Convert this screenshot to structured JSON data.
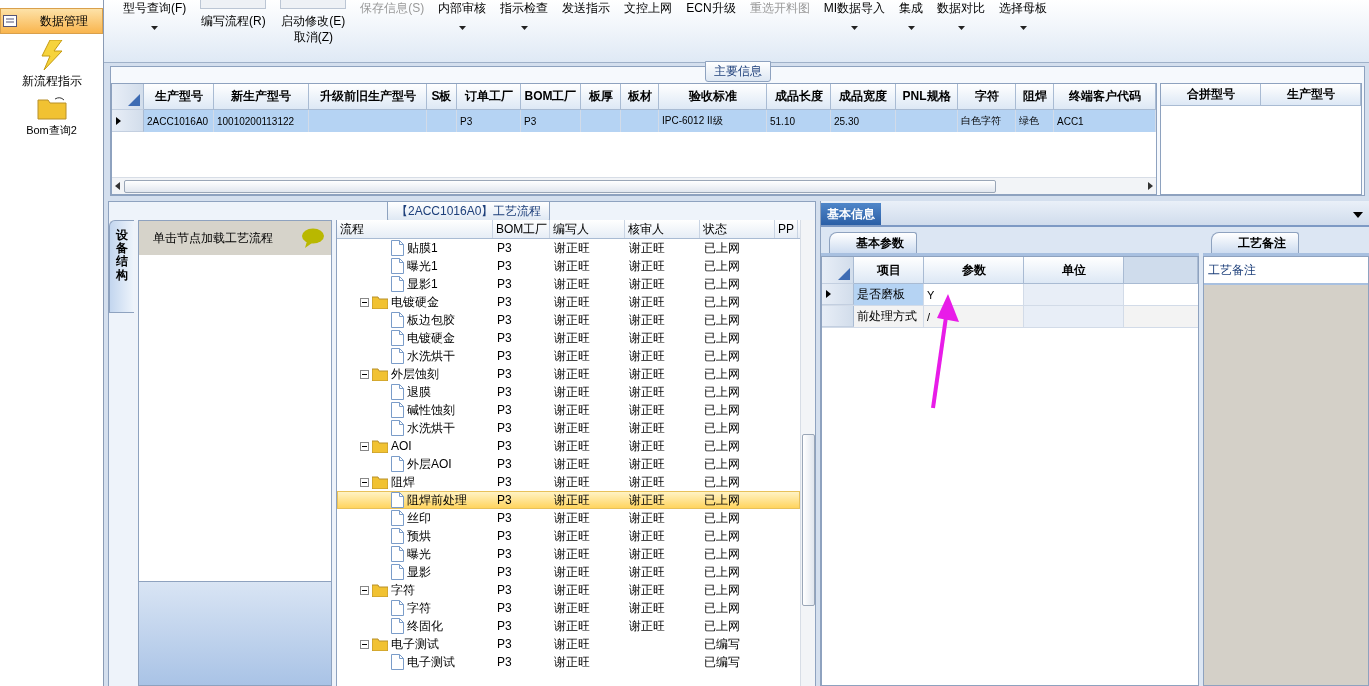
{
  "sidebar": {
    "items": [
      {
        "label": "数据管理",
        "kind": "nav",
        "selected": true
      },
      {
        "label": "新流程指示",
        "kind": "launcher",
        "selected": false
      },
      {
        "label": "Bom查询2",
        "kind": "launcher",
        "selected": false
      }
    ]
  },
  "toolbar": {
    "items": [
      {
        "label": "型号查询(F)",
        "kind": "text",
        "caret": true,
        "disabled": false
      },
      {
        "label": "编写流程(R)",
        "kind": "icon",
        "caret": false,
        "disabled": false
      },
      {
        "label": "启动修改(E)",
        "second_line": "取消(Z)",
        "kind": "icon",
        "caret": false,
        "disabled": false
      },
      {
        "label": "保存信息(S)",
        "kind": "text",
        "caret": false,
        "disabled": true
      },
      {
        "label": "内部审核",
        "kind": "text",
        "caret": true,
        "disabled": false
      },
      {
        "label": "指示检查",
        "kind": "text",
        "caret": true,
        "disabled": false
      },
      {
        "label": "发送指示",
        "kind": "text",
        "caret": false,
        "disabled": false
      },
      {
        "label": "文控上网",
        "kind": "text",
        "caret": false,
        "disabled": false
      },
      {
        "label": "ECN升级",
        "kind": "text",
        "caret": false,
        "disabled": false
      },
      {
        "label": "重选开料图",
        "kind": "text",
        "caret": false,
        "disabled": true
      },
      {
        "label": "MI数据导入",
        "kind": "text",
        "caret": true,
        "disabled": false
      },
      {
        "label": "集成",
        "kind": "text",
        "caret": true,
        "disabled": false
      },
      {
        "label": "数据对比",
        "kind": "text",
        "caret": true,
        "disabled": false
      },
      {
        "label": "选择母板",
        "kind": "text",
        "caret": true,
        "disabled": false
      }
    ]
  },
  "main_info": {
    "title": "主要信息",
    "table": {
      "columns": [
        "生产型号",
        "新生产型号",
        "升级前旧生产型号",
        "S板",
        "订单工厂",
        "BOM工厂",
        "板厚",
        "板材",
        "验收标准",
        "成品长度",
        "成品宽度",
        "PNL规格",
        "字符",
        "阻焊",
        "终端客户代码"
      ],
      "rows": [
        {
          "selected": true,
          "cells": [
            "2ACC1016A0",
            "10010200113122",
            null,
            null,
            "P3",
            "P3",
            null,
            null,
            "IPC-6012 II级",
            "51.10",
            "25.30",
            null,
            "白色字符",
            "绿色",
            "ACC1"
          ]
        }
      ]
    },
    "merge_table": {
      "columns": [
        "合拼型号",
        "生产型号"
      ]
    }
  },
  "process": {
    "title": "【2ACC1016A0】工艺流程",
    "side_tab": {
      "label": "设备结构",
      "selected": true
    },
    "hint": "单击节点加载工艺流程",
    "tree": {
      "columns": [
        "流程",
        "BOM工厂",
        "编写人",
        "核审人",
        "状态",
        "PP"
      ],
      "nodes": [
        {
          "children": [
            {
              "name": "贴膜1",
              "cells": [
                "P3",
                "谢正旺",
                "谢正旺",
                "已上网"
              ],
              "selected": false
            },
            {
              "name": "曝光1",
              "cells": [
                "P3",
                "谢正旺",
                "谢正旺",
                "已上网"
              ],
              "selected": false
            },
            {
              "name": "显影1",
              "cells": [
                "P3",
                "谢正旺",
                "谢正旺",
                "已上网"
              ],
              "selected": false
            }
          ]
        },
        {
          "name": "电镀硬金",
          "cells": [
            "P3",
            "谢正旺",
            "谢正旺",
            "已上网"
          ],
          "selected": false,
          "expanded": true,
          "children": [
            {
              "name": "板边包胶",
              "cells": [
                "P3",
                "谢正旺",
                "谢正旺",
                "已上网"
              ],
              "selected": false
            },
            {
              "name": "电镀硬金",
              "cells": [
                "P3",
                "谢正旺",
                "谢正旺",
                "已上网"
              ],
              "selected": false
            },
            {
              "name": "水洗烘干",
              "cells": [
                "P3",
                "谢正旺",
                "谢正旺",
                "已上网"
              ],
              "selected": false
            }
          ]
        },
        {
          "name": "外层蚀刻",
          "cells": [
            "P3",
            "谢正旺",
            "谢正旺",
            "已上网"
          ],
          "selected": false,
          "expanded": true,
          "children": [
            {
              "name": "退膜",
              "cells": [
                "P3",
                "谢正旺",
                "谢正旺",
                "已上网"
              ],
              "selected": false
            },
            {
              "name": "碱性蚀刻",
              "cells": [
                "P3",
                "谢正旺",
                "谢正旺",
                "已上网"
              ],
              "selected": false
            },
            {
              "name": "水洗烘干",
              "cells": [
                "P3",
                "谢正旺",
                "谢正旺",
                "已上网"
              ],
              "selected": false
            }
          ]
        },
        {
          "name": "AOI",
          "cells": [
            "P3",
            "谢正旺",
            "谢正旺",
            "已上网"
          ],
          "selected": false,
          "expanded": true,
          "children": [
            {
              "name": "外层AOI",
              "cells": [
                "P3",
                "谢正旺",
                "谢正旺",
                "已上网"
              ],
              "selected": false
            }
          ]
        },
        {
          "name": "阻焊",
          "cells": [
            "P3",
            "谢正旺",
            "谢正旺",
            "已上网"
          ],
          "selected": false,
          "expanded": true,
          "children": [
            {
              "name": "阻焊前处理",
              "cells": [
                "P3",
                "谢正旺",
                "谢正旺",
                "已上网"
              ],
              "selected": true
            },
            {
              "name": "丝印",
              "cells": [
                "P3",
                "谢正旺",
                "谢正旺",
                "已上网"
              ],
              "selected": false
            },
            {
              "name": "预烘",
              "cells": [
                "P3",
                "谢正旺",
                "谢正旺",
                "已上网"
              ],
              "selected": false
            },
            {
              "name": "曝光",
              "cells": [
                "P3",
                "谢正旺",
                "谢正旺",
                "已上网"
              ],
              "selected": false
            },
            {
              "name": "显影",
              "cells": [
                "P3",
                "谢正旺",
                "谢正旺",
                "已上网"
              ],
              "selected": false
            }
          ]
        },
        {
          "name": "字符",
          "cells": [
            "P3",
            "谢正旺",
            "谢正旺",
            "已上网"
          ],
          "selected": false,
          "expanded": true,
          "children": [
            {
              "name": "字符",
              "cells": [
                "P3",
                "谢正旺",
                "谢正旺",
                "已上网"
              ],
              "selected": false
            },
            {
              "name": "终固化",
              "cells": [
                "P3",
                "谢正旺",
                "谢正旺",
                "已上网"
              ],
              "selected": false
            }
          ]
        },
        {
          "name": "电子测试",
          "cells": [
            "P3",
            "谢正旺",
            null,
            "已编写"
          ],
          "selected": false,
          "expanded": true,
          "children": [
            {
              "name": "电子测试",
              "cells": [
                "P3",
                "谢正旺",
                null,
                "已编写"
              ],
              "selected": false
            }
          ]
        }
      ]
    }
  },
  "detail": {
    "tabs": [
      {
        "label": "基本信息",
        "selected": true
      }
    ],
    "params": {
      "tab": "基本参数",
      "columns": [
        "项目",
        "参数",
        "单位"
      ],
      "rows": [
        {
          "item": "是否磨板",
          "value": "Y",
          "selected": true
        },
        {
          "item": "前处理方式",
          "value": "/",
          "selected": false
        }
      ]
    },
    "notes": {
      "tab": "工艺备注",
      "header": "工艺备注"
    }
  }
}
